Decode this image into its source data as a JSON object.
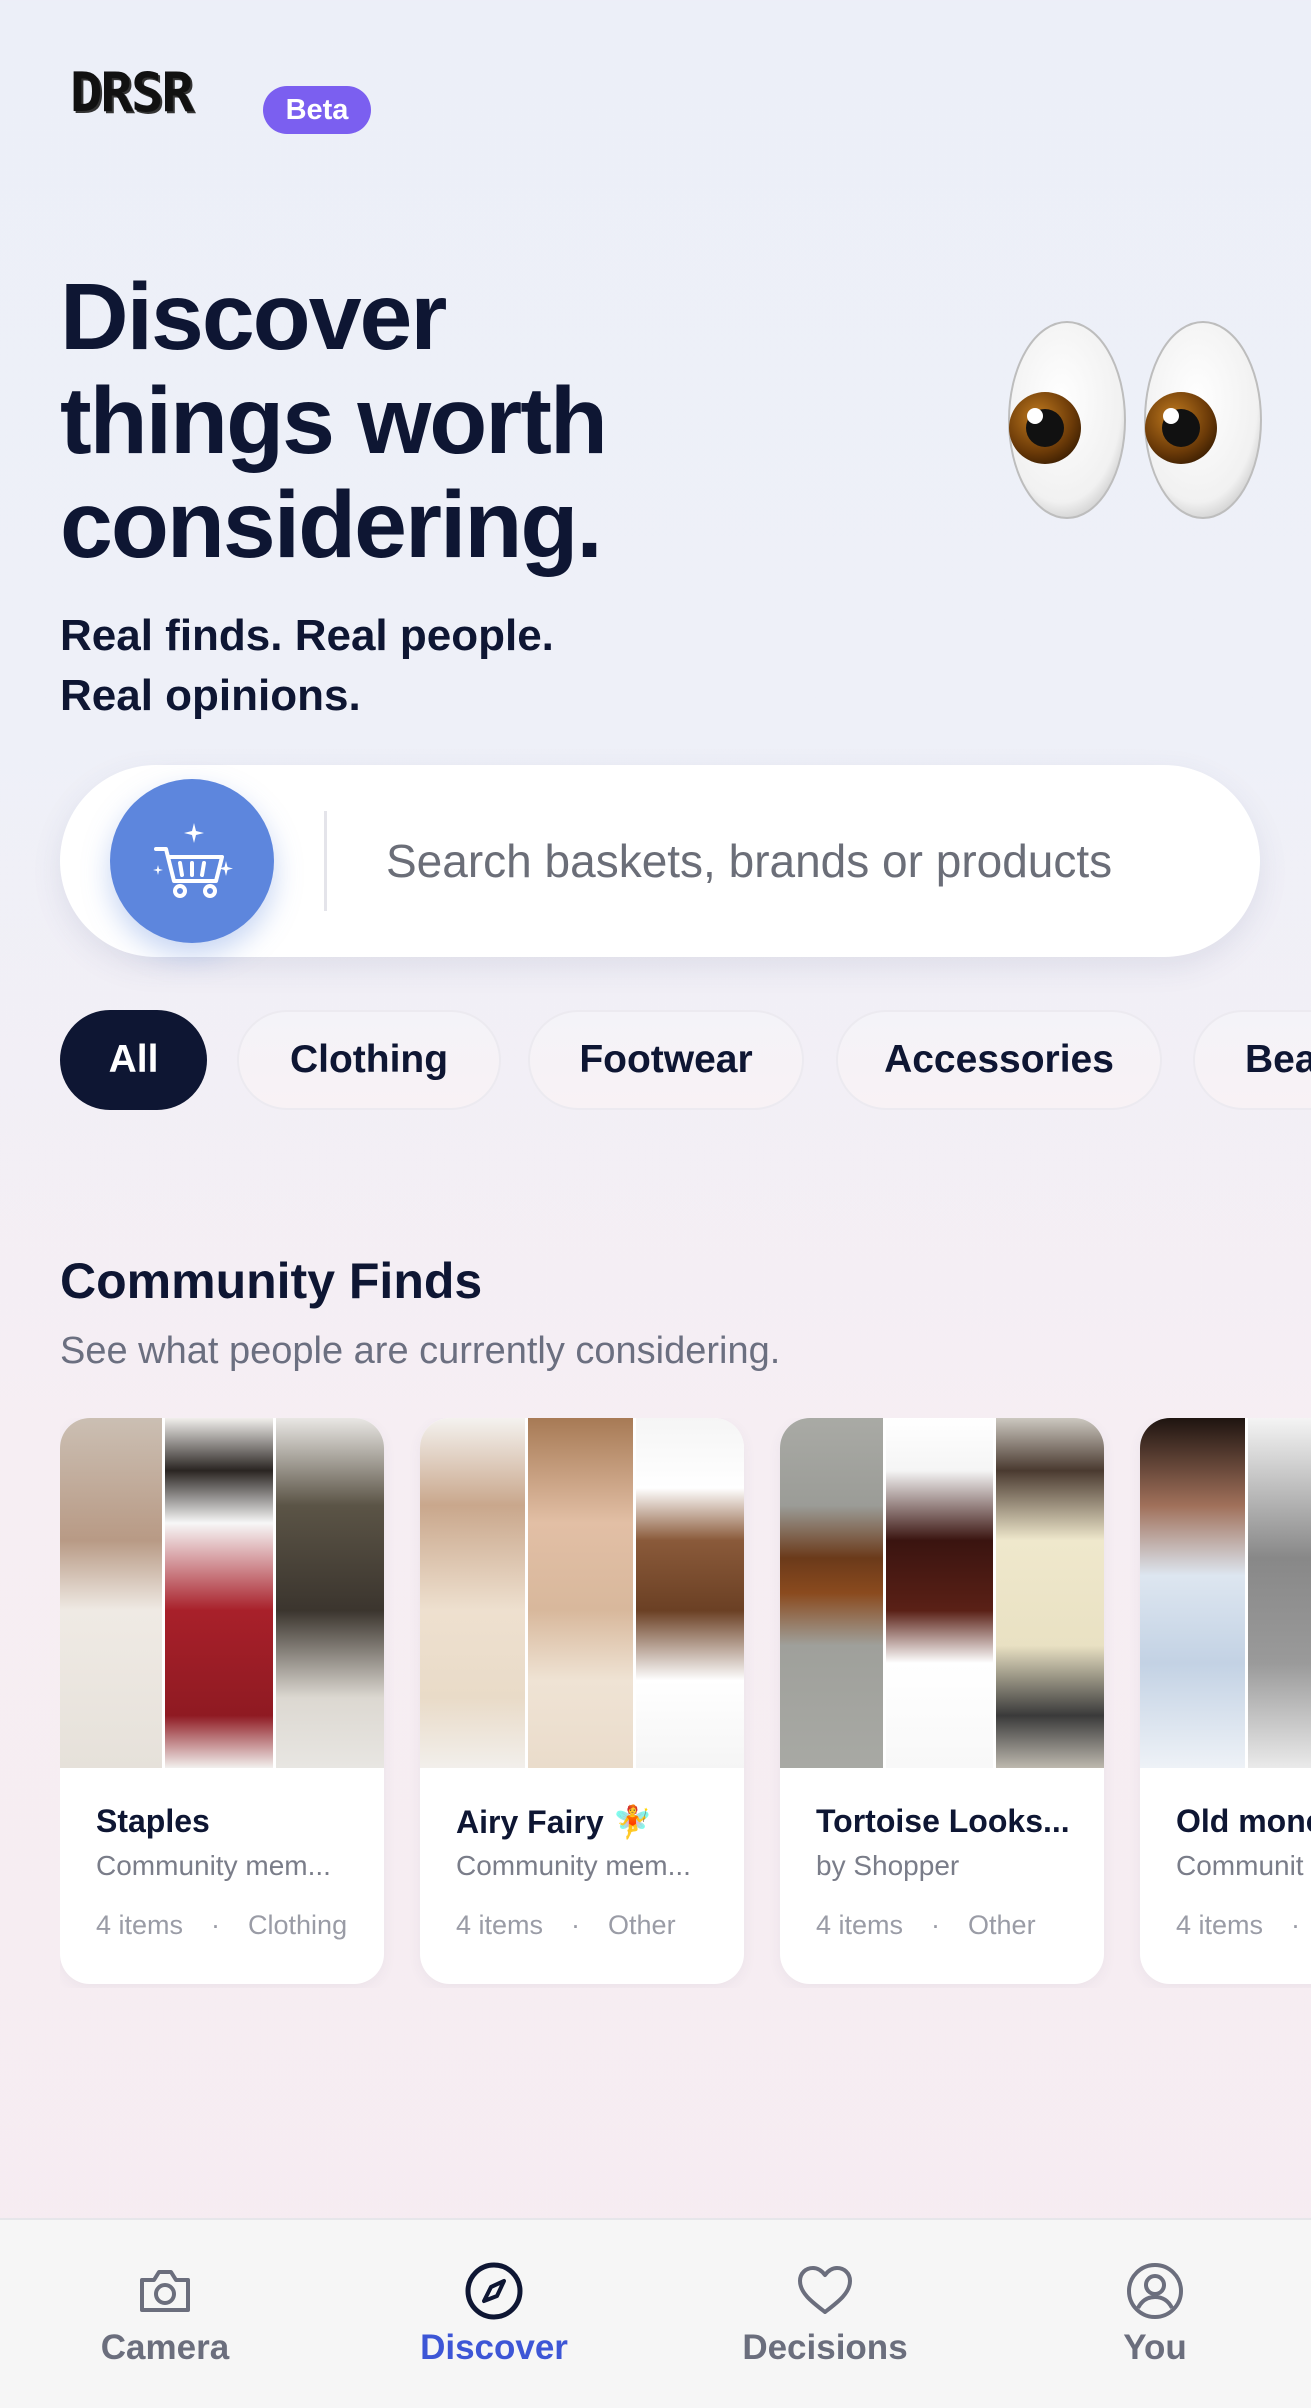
{
  "app": {
    "logo": "DRSR",
    "badge": "Beta"
  },
  "hero": {
    "headline_lines": [
      "Discover",
      "things worth",
      "considering."
    ],
    "subline_lines": [
      "Real finds. Real people.",
      "Real opinions."
    ],
    "emoji": "eyes"
  },
  "search": {
    "placeholder": "Search baskets, brands or products",
    "icon": "cart-sparkle-icon"
  },
  "categories": [
    "All",
    "Clothing",
    "Footwear",
    "Accessories",
    "Bea"
  ],
  "community": {
    "title": "Community Finds",
    "subtitle": "See what people are currently considering.",
    "cards": [
      {
        "title": "Staples",
        "by": "Community mem...",
        "count": "4 items",
        "category": "Clothing"
      },
      {
        "title": "Airy Fairy 🧚",
        "by": "Community mem...",
        "count": "4 items",
        "category": "Other"
      },
      {
        "title": "Tortoise Looks...",
        "by": "by Shopper",
        "count": "4 items",
        "category": "Other"
      },
      {
        "title": "Old mone",
        "by": "Communit",
        "count": "4 items",
        "category": ""
      }
    ]
  },
  "tabs": [
    {
      "label": "Camera",
      "icon": "camera-icon"
    },
    {
      "label": "Discover",
      "icon": "compass-icon",
      "active": true
    },
    {
      "label": "Decisions",
      "icon": "heart-icon"
    },
    {
      "label": "You",
      "icon": "user-icon"
    }
  ],
  "colors": {
    "brand": "#7b5ff0",
    "navy": "#0e1633",
    "accent": "#3d56d6",
    "cart": "#5d86dd"
  }
}
